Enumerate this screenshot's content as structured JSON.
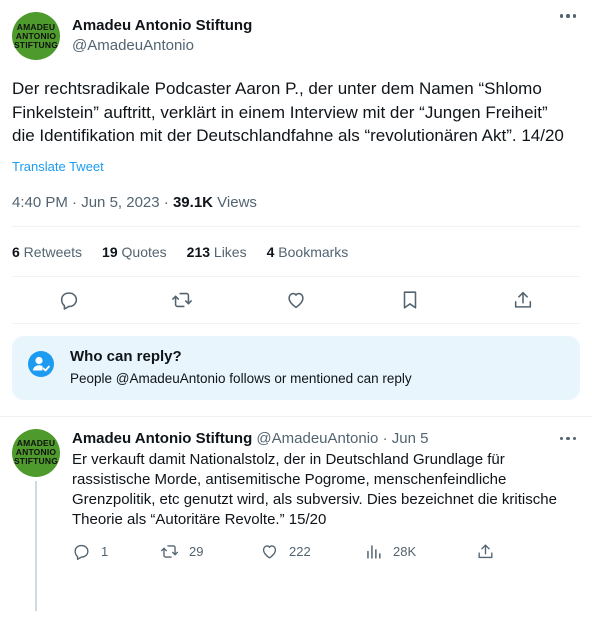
{
  "tweet": {
    "avatar_text": [
      "AMADEU",
      "ANTONIO",
      "STIFTUNG"
    ],
    "author_name": "Amadeu Antonio Stiftung",
    "author_handle": "@AmadeuAntonio",
    "text": "Der rechtsradikale Podcaster Aaron P., der unter dem Namen “Shlomo Finkelstein” auftritt, verklärt in einem Interview mit der “Jungen Freiheit” die Identifikation mit der Deutschlandfahne als “revolutionären Akt”. 14/20",
    "translate_label": "Translate Tweet",
    "time": "4:40 PM",
    "sep": " · ",
    "date": "Jun 5, 2023",
    "views_count": "39.1K",
    "views_label": " Views",
    "stats": {
      "retweets_count": "6",
      "retweets_label": " Retweets",
      "quotes_count": "19",
      "quotes_label": " Quotes",
      "likes_count": "213",
      "likes_label": " Likes",
      "bookmarks_count": "4",
      "bookmarks_label": " Bookmarks"
    }
  },
  "reply_restriction": {
    "title": "Who can reply?",
    "subtitle": "People @AmadeuAntonio follows or mentioned can reply"
  },
  "reply_tweet": {
    "author_name": "Amadeu Antonio Stiftung",
    "author_handle": "@AmadeuAntonio",
    "sep": " · ",
    "date": "Jun 5",
    "text": "Er verkauft damit Nationalstolz, der in Deutschland Grundlage für rassistische Morde, antisemitische Pogrome, menschenfeindliche Grenzpolitik, etc genutzt wird, als subversiv. Dies bezeichnet die kritische Theorie als “Autoritäre Revolte.” 15/20",
    "replies": "1",
    "retweets": "29",
    "likes": "222",
    "views": "28K"
  },
  "colors": {
    "accent": "#1d9bf0",
    "muted": "#536471",
    "avatar_green": "#4e9a2d",
    "reply_bg": "#e8f5fd"
  },
  "icons": [
    "more-icon",
    "reply-icon",
    "retweet-icon",
    "like-icon",
    "bookmark-icon",
    "share-icon",
    "person-check-icon",
    "views-icon"
  ]
}
